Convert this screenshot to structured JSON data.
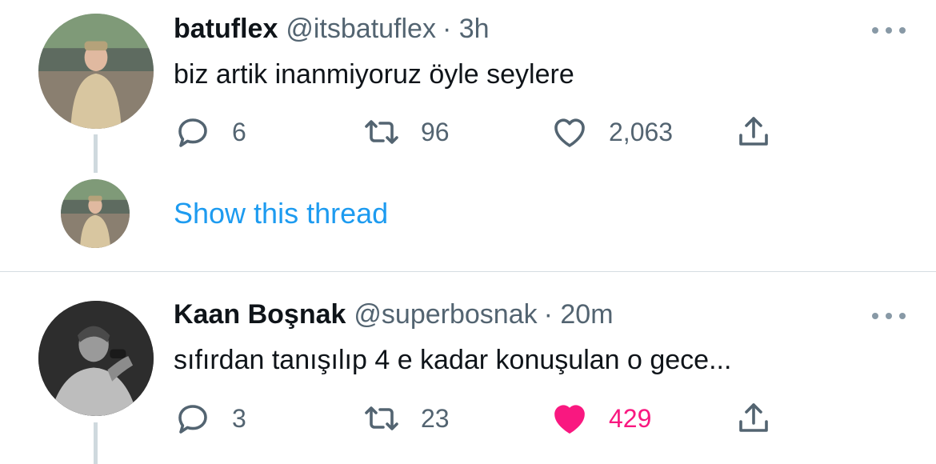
{
  "colors": {
    "text_primary": "#0f1419",
    "text_secondary": "#536471",
    "link": "#1d9bf0",
    "like_active": "#f91880",
    "thread_line": "#cfd9de"
  },
  "tweets": [
    {
      "name": "batuflex",
      "handle": "@itsbatuflex",
      "time": "· 3h",
      "text": "biz artik inanmiyoruz öyle seylere",
      "replies": "6",
      "retweets": "96",
      "likes": "2,063",
      "liked": false
    },
    {
      "name": "Kaan Boşnak",
      "handle": "@superbosnak",
      "time": "· 20m",
      "text": "sıfırdan tanışılıp 4 e kadar konuşulan o gece...",
      "replies": "3",
      "retweets": "23",
      "likes": "429",
      "liked": true
    }
  ],
  "thread": {
    "show_label": "Show this thread"
  },
  "icons": [
    "reply-icon",
    "retweet-icon",
    "like-icon",
    "share-icon",
    "more-icon"
  ]
}
